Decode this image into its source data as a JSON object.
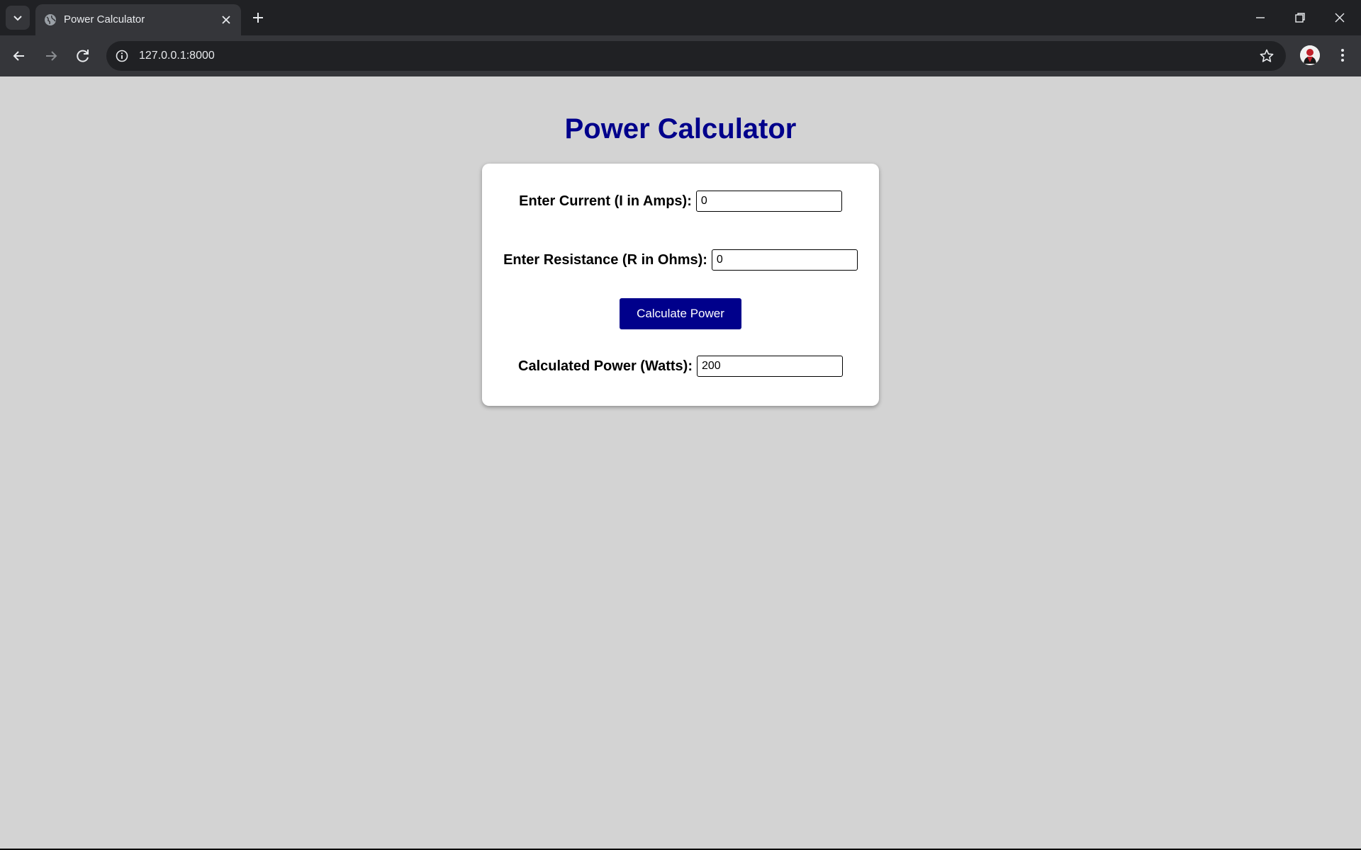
{
  "browser": {
    "tab_title": "Power Calculator",
    "url": "127.0.0.1:8000"
  },
  "page": {
    "title": "Power Calculator",
    "current_label": "Enter Current (I in Amps):",
    "current_value": "0",
    "resistance_label": "Enter Resistance (R in Ohms):",
    "resistance_value": "0",
    "button_label": "Calculate Power",
    "power_label": "Calculated Power (Watts):",
    "power_value": "200"
  },
  "colors": {
    "title": "#00008b",
    "button": "#00008b",
    "background": "#d3d3d3"
  }
}
